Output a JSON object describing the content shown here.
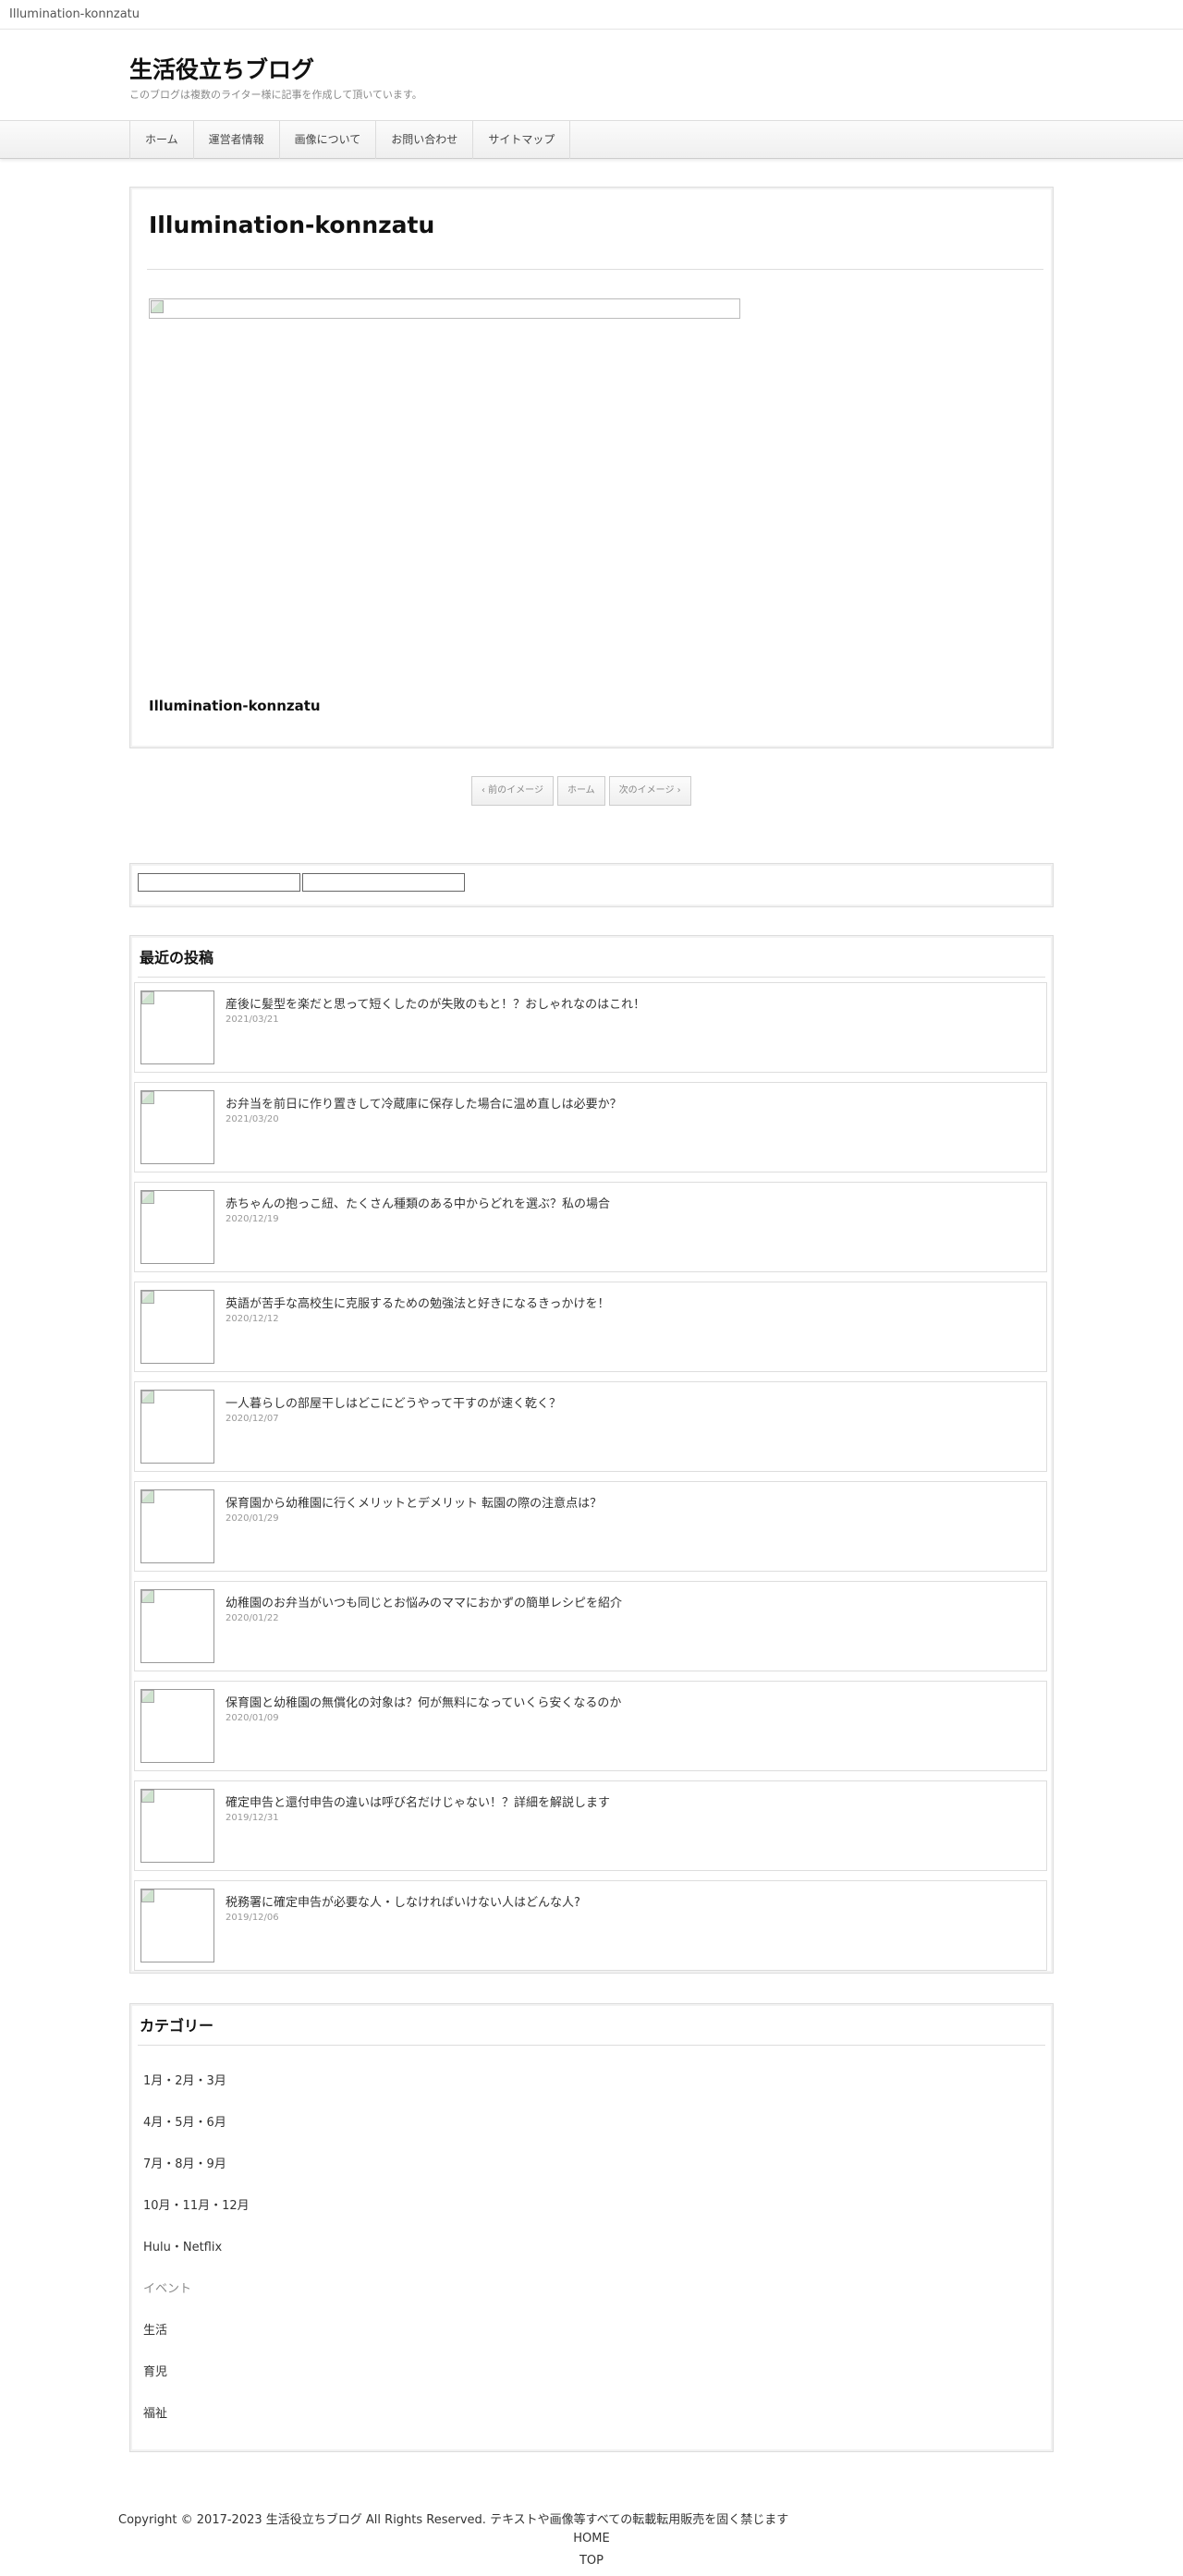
{
  "window": {
    "title": "Illumination-konnzatu"
  },
  "header": {
    "site_title": "生活役立ちブログ",
    "site_description": "このブログは複数のライター様に記事を作成して頂いています。"
  },
  "nav": {
    "items": [
      {
        "label": "ホーム"
      },
      {
        "label": "運営者情報"
      },
      {
        "label": "画像について"
      },
      {
        "label": "お問い合わせ"
      },
      {
        "label": "サイトマップ"
      }
    ]
  },
  "article": {
    "title": "Illumination-konnzatu",
    "image_icon": "broken-image-icon",
    "caption": "Illumination-konnzatu"
  },
  "pager": {
    "prev": "‹ 前のイメージ",
    "home": "ホーム",
    "next": "次のイメージ ›"
  },
  "recent_posts": {
    "title": "最近の投稿",
    "posts": [
      {
        "title": "産後に髪型を楽だと思って短くしたのが失敗のもと！？おしゃれなのはこれ！",
        "date": "2021/03/21"
      },
      {
        "title": "お弁当を前日に作り置きして冷蔵庫に保存した場合に温め直しは必要か？",
        "date": "2021/03/20"
      },
      {
        "title": "赤ちゃんの抱っこ紐、たくさん種類のある中からどれを選ぶ？私の場合",
        "date": "2020/12/19"
      },
      {
        "title": "英語が苦手な高校生に克服するための勉強法と好きになるきっかけを！",
        "date": "2020/12/12"
      },
      {
        "title": "一人暮らしの部屋干しはどこにどうやって干すのが速く乾く？",
        "date": "2020/12/07"
      },
      {
        "title": "保育園から幼稚園に行くメリットとデメリット 転園の際の注意点は？",
        "date": "2020/01/29"
      },
      {
        "title": "幼稚園のお弁当がいつも同じとお悩みのママにおかずの簡単レシピを紹介",
        "date": "2020/01/22"
      },
      {
        "title": "保育園と幼稚園の無償化の対象は？何が無料になっていくら安くなるのか",
        "date": "2020/01/09"
      },
      {
        "title": "確定申告と還付申告の違いは呼び名だけじゃない！？詳細を解説します",
        "date": "2019/12/31"
      },
      {
        "title": "税務署に確定申告が必要な人・しなければいけない人はどんな人?",
        "date": "2019/12/06"
      }
    ]
  },
  "categories": {
    "title": "カテゴリー",
    "items": [
      {
        "label": "1月・2月・3月"
      },
      {
        "label": "4月・5月・6月"
      },
      {
        "label": "7月・8月・9月"
      },
      {
        "label": "10月・11月・12月"
      },
      {
        "label": "Hulu・Netflix"
      },
      {
        "label": "イベント"
      },
      {
        "label": "生活"
      },
      {
        "label": "育児"
      },
      {
        "label": "福祉"
      }
    ]
  },
  "footer": {
    "copyright": "Copyright © 2017-2023 生活役立ちブログ All Rights Reserved. テキストや画像等すべての転載転用販売を固く禁じます",
    "home_link": "HOME",
    "top_link": "TOP"
  }
}
